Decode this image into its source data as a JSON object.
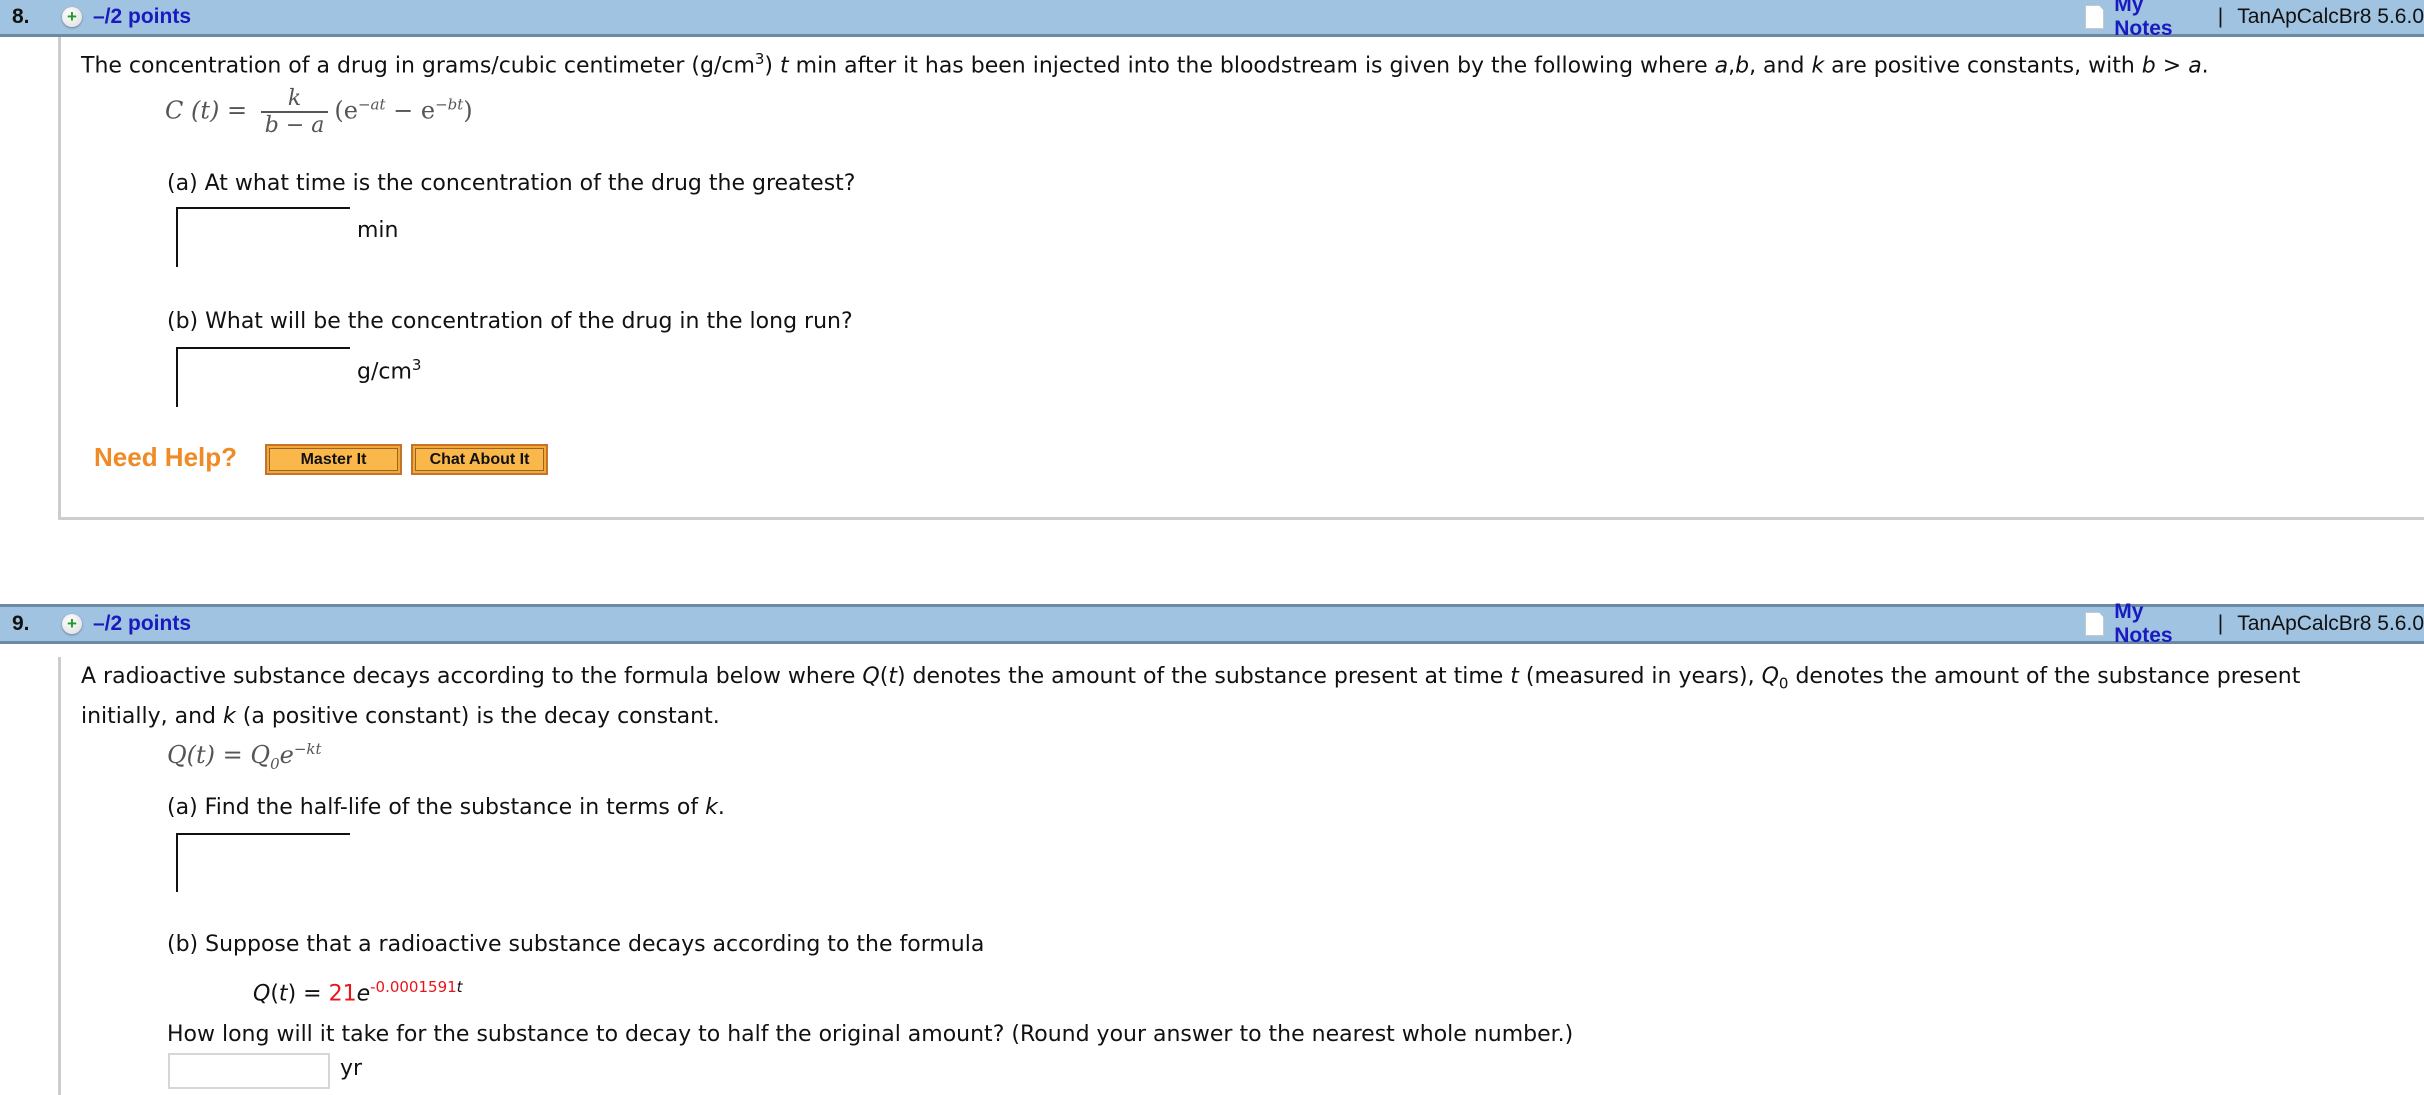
{
  "problems": [
    {
      "number": "8.",
      "points": "–/2 points",
      "my_notes": "My Notes",
      "separator": "|",
      "source": "TanApCalcBr8 5.6.0",
      "intro_parts": [
        "The concentration of a drug in grams/cubic centimeter (g/cm",
        "3",
        ") ",
        "t",
        " min after it has been injected into the bloodstream is given by the following where ",
        "a",
        ",",
        "b",
        ", and ",
        "k",
        " are positive constants, with ",
        "b",
        " > ",
        "a",
        "."
      ],
      "formula": {
        "lhs": "C (t) =",
        "numerator": "k",
        "denominator": "b − a",
        "rhs_open": "(e",
        "exp1": "−at",
        "minus": " − e",
        "exp2": "−bt",
        "rhs_close": ")"
      },
      "part_a": {
        "question": "(a) At what time is the concentration of the drug the greatest?",
        "answer": "",
        "unit": "min"
      },
      "part_b": {
        "question": "(b) What will be the concentration of the drug in the long run?",
        "answer": "",
        "unit_base": "g/cm",
        "unit_sup": "3"
      },
      "need_help": "Need Help?",
      "buttons": [
        "Master It",
        "Chat About It"
      ]
    },
    {
      "number": "9.",
      "points": "–/2 points",
      "my_notes": "My Notes",
      "separator": "|",
      "source": "TanApCalcBr8 5.6.0",
      "intro_line1_parts": [
        "A radioactive substance decays according to the formula below where ",
        "Q",
        "(",
        "t",
        ") denotes the amount of the substance present at time ",
        "t",
        " (measured in years), ",
        "Q",
        "0",
        " denotes the amount of the substance present"
      ],
      "intro_line2_parts": [
        "initially, and ",
        "k",
        " (a positive constant) is the decay constant."
      ],
      "formula": {
        "lhs": "Q(t) = Q",
        "sub": "0",
        "base": "e",
        "exp": "−kt"
      },
      "part_a": {
        "question_prefix": "(a) Find the half-life of the substance in terms of ",
        "question_var": "k",
        "question_suffix": ".",
        "answer": ""
      },
      "part_b": {
        "question": "(b) Suppose that a radioactive substance decays according to the formula",
        "eq_lhs_q": "Q",
        "eq_lhs_open": "(",
        "eq_lhs_t": "t",
        "eq_lhs_close": ") = ",
        "eq_coef": "21",
        "eq_base": "e",
        "eq_exp": "-0.0001591",
        "eq_exp_var": "t",
        "followup": "How long will it take for the substance to decay to half the original amount? (Round your answer to the nearest whole number.)",
        "answer": "",
        "unit": "yr"
      }
    }
  ],
  "colors": {
    "header_bg": "#9fc3e1",
    "link": "#1a1ac0",
    "help": "#f08a24",
    "button": "#fab84a",
    "highlight": "#e8141a"
  }
}
